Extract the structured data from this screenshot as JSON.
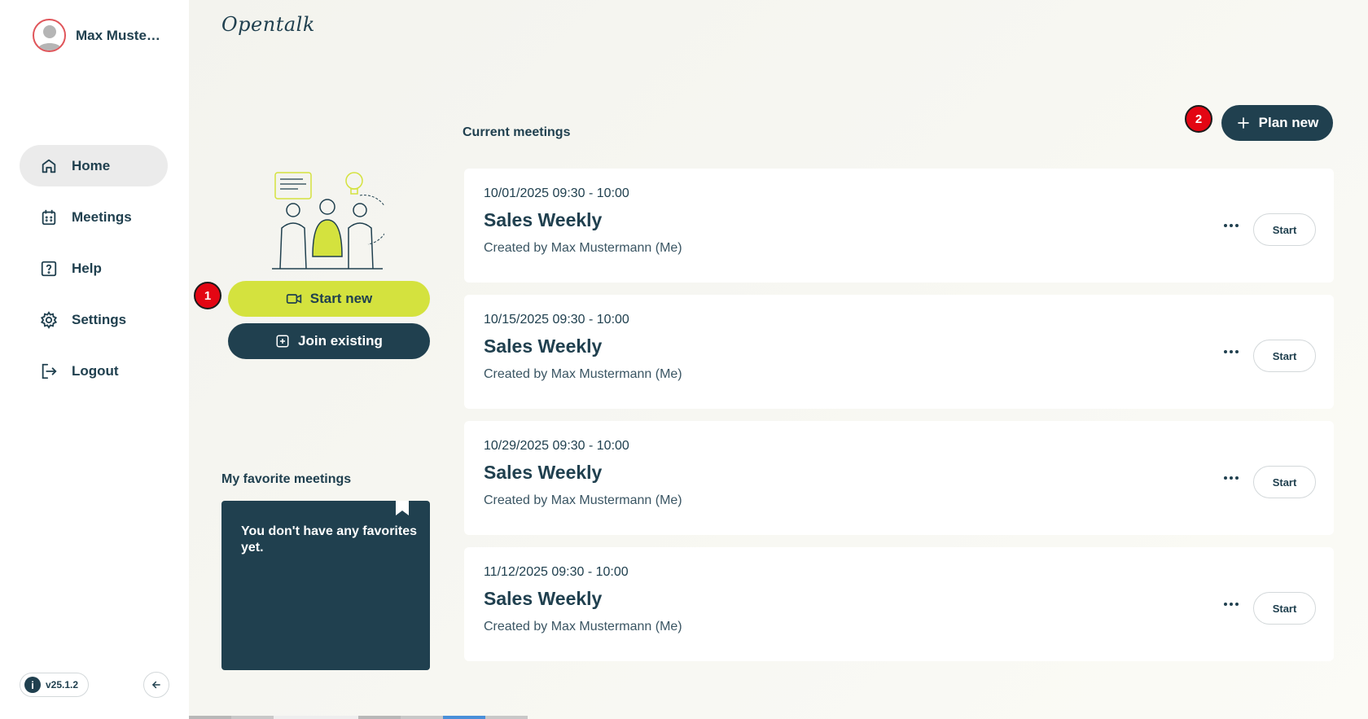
{
  "user": {
    "name": "Max Muste…"
  },
  "brand": {
    "logo_text": "Opentalk"
  },
  "sidebar": {
    "items": [
      {
        "label": "Home",
        "icon": "home-icon",
        "active": true
      },
      {
        "label": "Meetings",
        "icon": "calendar-icon",
        "active": false
      },
      {
        "label": "Help",
        "icon": "help-icon",
        "active": false
      },
      {
        "label": "Settings",
        "icon": "gear-icon",
        "active": false
      },
      {
        "label": "Logout",
        "icon": "logout-icon",
        "active": false
      }
    ],
    "version": "v25.1.2",
    "info_glyph": "i"
  },
  "markers": {
    "first": "1",
    "second": "2"
  },
  "actions": {
    "start_new_label": "Start new",
    "join_existing_label": "Join existing",
    "plan_new_label": "Plan new"
  },
  "favorites": {
    "title": "My favorite meetings",
    "empty_text": "You don't have any favorites yet."
  },
  "current_meetings": {
    "title": "Current meetings",
    "start_label": "Start",
    "items": [
      {
        "time": "10/01/2025 09:30 - 10:00",
        "title": "Sales Weekly",
        "creator": "Created by Max Mustermann (Me)"
      },
      {
        "time": "10/15/2025 09:30 - 10:00",
        "title": "Sales Weekly",
        "creator": "Created by Max Mustermann (Me)"
      },
      {
        "time": "10/29/2025 09:30 - 10:00",
        "title": "Sales Weekly",
        "creator": "Created by Max Mustermann (Me)"
      },
      {
        "time": "11/12/2025 09:30 - 10:00",
        "title": "Sales Weekly",
        "creator": "Created by Max Mustermann (Me)"
      }
    ]
  },
  "colors": {
    "primary": "#20404f",
    "accent": "#d4e23e",
    "marker": "#e30613",
    "active_nav": "#ebebeb"
  }
}
